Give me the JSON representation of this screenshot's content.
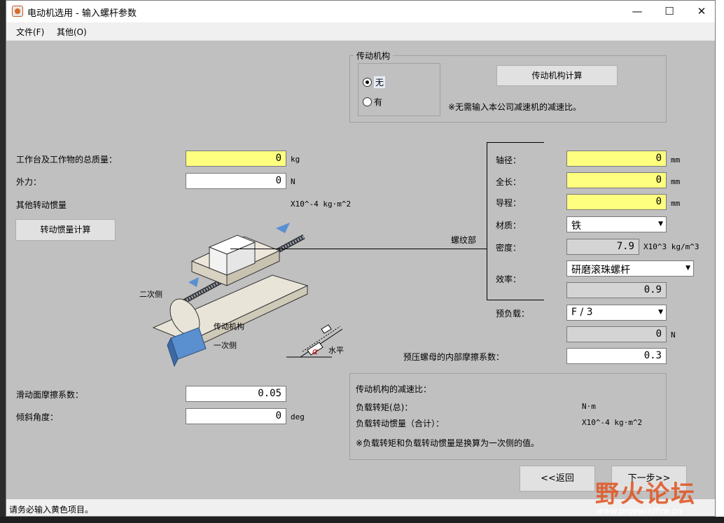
{
  "window": {
    "title": "电动机选用 - 输入螺杆参数",
    "minimize": "—",
    "maximize": "☐",
    "close": "✕"
  },
  "menu": {
    "file": "文件(F)",
    "other": "其他(O)"
  },
  "transmission": {
    "group_label": "传动机构",
    "option_none": "无",
    "option_have": "有",
    "selected": "无",
    "calc_button": "传动机构计算",
    "note": "※无需输入本公司减速机的减速比。"
  },
  "left": {
    "total_mass_label": "工作台及工作物的总质量：",
    "total_mass_value": "0",
    "total_mass_unit": "kg",
    "external_force_label": "外力：",
    "external_force_value": "0",
    "external_force_unit": "N",
    "other_inertia_label": "其他转动惯量",
    "other_inertia_unit": "X10^-4 kg·m^2",
    "inertia_calc_button": "转动惯量计算",
    "friction_label": "滑动面摩擦系数：",
    "friction_value": "0.05",
    "incline_label": "倾斜角度：",
    "incline_value": "0",
    "incline_unit": "deg"
  },
  "diagram": {
    "secondary_side": "二次侧",
    "mechanism": "传动机构",
    "primary_side": "一次侧",
    "horizontal": "水平",
    "alpha": "α",
    "screw_part": "螺纹部"
  },
  "screw": {
    "diameter_label": "轴径：",
    "diameter_value": "0",
    "diameter_unit": "mm",
    "length_label": "全长：",
    "length_value": "0",
    "length_unit": "mm",
    "lead_label": "导程：",
    "lead_value": "0",
    "lead_unit": "mm",
    "material_label": "材质：",
    "material_value": "铁",
    "density_label": "密度：",
    "density_value": "7.9",
    "density_unit": "X10^3 kg/m^3",
    "efficiency_label": "效率：",
    "efficiency_type": "研磨滚珠螺杆",
    "efficiency_value": "0.9",
    "preload_label": "预负载：",
    "preload_value": "F / 3",
    "preload_force": "0",
    "preload_force_unit": "N",
    "nut_friction_label": "预压螺母的内部摩擦系数：",
    "nut_friction_value": "0.3"
  },
  "result": {
    "ratio_label": "传动机构的减速比：",
    "torque_label": "负载转矩(总)：",
    "torque_unit": "N·m",
    "inertia_label": "负载转动惯量（合计）：",
    "inertia_unit": "X10^-4 kg·m^2",
    "note": "※负载转矩和负载转动惯量是换算为一次侧的值。"
  },
  "nav": {
    "back": "<<返回",
    "next": "下一步>>"
  },
  "status": "请务必输入黄色项目。",
  "watermark": {
    "text": "野火论坛",
    "url": "www.proewildfire.cn"
  }
}
